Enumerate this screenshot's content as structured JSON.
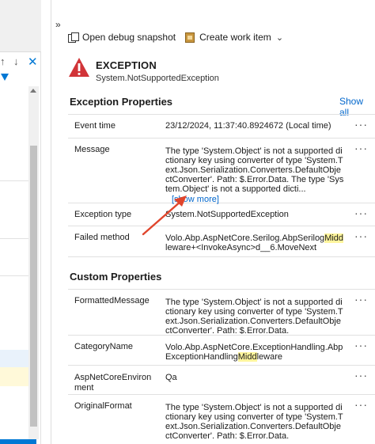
{
  "nav": {
    "collapse_glyph": "»",
    "up_glyph": "↑",
    "down_glyph": "↓",
    "close_glyph": "✕"
  },
  "toolbar": {
    "snapshot_label": "Open debug snapshot",
    "work_item_label": "Create work item",
    "chevron_glyph": "⌄"
  },
  "exception": {
    "title": "EXCEPTION",
    "type": "System.NotSupportedException"
  },
  "exception_properties": {
    "heading": "Exception Properties",
    "show_all": "Show all",
    "more_glyph": "···",
    "rows": {
      "event_time": {
        "key": "Event time",
        "value": "23/12/2024, 11:37:40.8924672 (Local time)"
      },
      "message": {
        "key": "Message",
        "value": "The type 'System.Object' is not a supported dictionary key using converter of type 'System.Text.Json.Serialization.Converters.DefaultObjectConverter'. Path: $.Error.Data. The type 'System.Object' is not a supported dicti...",
        "show_more": "[show more]"
      },
      "exception_type": {
        "key": "Exception type",
        "value": "System.NotSupportedException"
      },
      "failed_method": {
        "key": "Failed method",
        "value_before": "Volo.Abp.AspNetCore.Serilog.AbpSerilog",
        "value_highlight": "Midd",
        "value_after": "leware+<InvokeAsync>d__6.MoveNext"
      }
    }
  },
  "custom_properties": {
    "heading": "Custom Properties",
    "rows": {
      "formatted_message": {
        "key": "FormattedMessage",
        "value": "The type 'System.Object' is not a supported dictionary key using converter of type 'System.Text.Json.Serialization.Converters.DefaultObjectConverter'. Path: $.Error.Data."
      },
      "category_name": {
        "key": "CategoryName",
        "value_before": "Volo.Abp.AspNetCore.ExceptionHandling.AbpExceptionHandling",
        "value_highlight": "Midd",
        "value_after": "leware"
      },
      "environment": {
        "key": "AspNetCoreEnvironment",
        "value": "Qa"
      },
      "original_format": {
        "key": "OriginalFormat",
        "value": "The type 'System.Object' is not a supported dictionary key using converter of type 'System.Text.Json.Serialization.Converters.DefaultObjectConverter'. Path: $.Error.Data."
      }
    }
  },
  "colors": {
    "accent": "#0078d4",
    "link": "#0066cc",
    "error_red": "#d13438",
    "highlight": "#fff59d",
    "annotation_arrow": "#e0452c"
  }
}
